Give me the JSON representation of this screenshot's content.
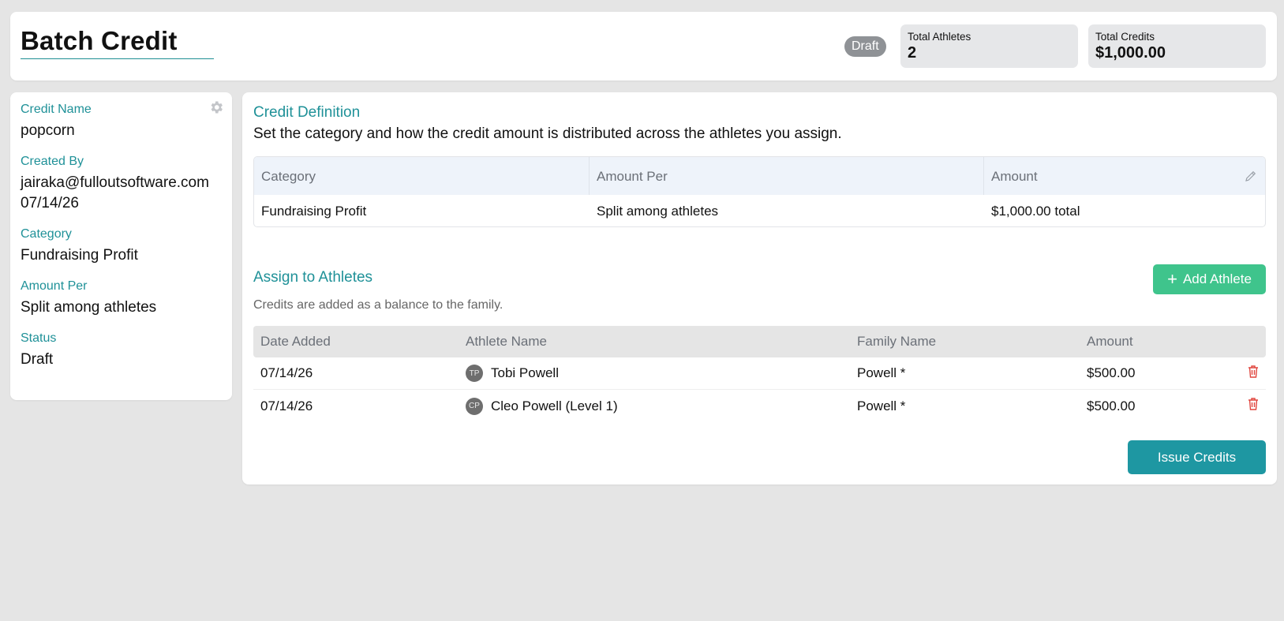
{
  "header": {
    "title": "Batch Credit",
    "status_badge": "Draft",
    "stats": [
      {
        "label": "Total Athletes",
        "value": "2"
      },
      {
        "label": "Total Credits",
        "value": "$1,000.00"
      }
    ]
  },
  "sidebar": {
    "fields": [
      {
        "label": "Credit Name",
        "value": "popcorn"
      },
      {
        "label": "Created By",
        "value": "jairaka@fulloutsoftware.com",
        "value2": "07/14/26"
      },
      {
        "label": "Category",
        "value": "Fundraising Profit"
      },
      {
        "label": "Amount Per",
        "value": "Split among athletes"
      },
      {
        "label": "Status",
        "value": "Draft"
      }
    ],
    "settings_icon": "gear-icon"
  },
  "definition": {
    "title": "Credit Definition",
    "description": "Set the category and how the credit amount is distributed across the athletes you assign.",
    "columns": [
      "Category",
      "Amount Per",
      "Amount"
    ],
    "row": [
      "Fundraising Profit",
      "Split among athletes",
      "$1,000.00 total"
    ],
    "edit_icon": "pencil-icon"
  },
  "assign": {
    "title": "Assign to Athletes",
    "description": "Credits are added as a balance to the family.",
    "add_button": "Add Athlete",
    "add_button_color": "#3fc48c",
    "columns": [
      "Date Added",
      "Athlete Name",
      "Family Name",
      "Amount"
    ],
    "rows": [
      {
        "date": "07/14/26",
        "initials": "TP",
        "athlete": "Tobi Powell",
        "family": "Powell *",
        "amount": "$500.00"
      },
      {
        "date": "07/14/26",
        "initials": "CP",
        "athlete": "Cleo Powell (Level 1)",
        "family": "Powell *",
        "amount": "$500.00"
      }
    ],
    "delete_icon": "trash-icon"
  },
  "actions": {
    "issue_button": "Issue Credits",
    "issue_button_color": "#1e97a2"
  },
  "colors": {
    "accent": "#1f9198",
    "danger": "#e0463f",
    "badge": "#8f9296"
  }
}
